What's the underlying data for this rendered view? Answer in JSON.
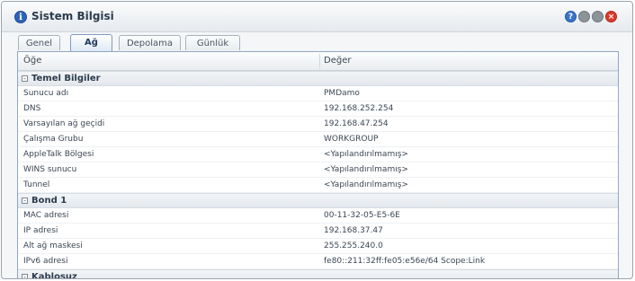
{
  "window": {
    "title": "Sistem Bilgisi",
    "icon": "info-icon"
  },
  "controls": {
    "help": "?",
    "close": "×"
  },
  "tabs": [
    {
      "label": "Genel"
    },
    {
      "label": "Ağ"
    },
    {
      "label": "Depolama"
    },
    {
      "label": "Günlük"
    }
  ],
  "table": {
    "columns": [
      "Öğe",
      "Değer"
    ],
    "groups": [
      {
        "label": "Temel Bilgiler",
        "rows": [
          {
            "key": "Sunucu adı",
            "value": "PMDamo"
          },
          {
            "key": "DNS",
            "value": "192.168.252.254"
          },
          {
            "key": "Varsayılan ağ geçidi",
            "value": "192.168.47.254"
          },
          {
            "key": "Çalışma Grubu",
            "value": "WORKGROUP"
          },
          {
            "key": "AppleTalk Bölgesi",
            "value": "<Yapılandırılmamış>"
          },
          {
            "key": "WINS sunucu",
            "value": "<Yapılandırılmamış>"
          },
          {
            "key": "Tunnel",
            "value": "<Yapılandırılmamış>"
          }
        ]
      },
      {
        "label": "Bond 1",
        "rows": [
          {
            "key": "MAC adresi",
            "value": "00-11-32-05-E5-6E"
          },
          {
            "key": "IP adresi",
            "value": "192.168.37.47"
          },
          {
            "key": "Alt ağ maskesi",
            "value": "255.255.240.0"
          },
          {
            "key": "IPv6 adresi",
            "value": "fe80::211:32ff:fe05:e56e/64 Scope:Link"
          }
        ]
      },
      {
        "label": "Kablosuz",
        "rows": []
      }
    ]
  },
  "colors": {
    "accent": "#2f63b8",
    "close": "#d93b2b",
    "panel_border": "#8fa6c2"
  }
}
